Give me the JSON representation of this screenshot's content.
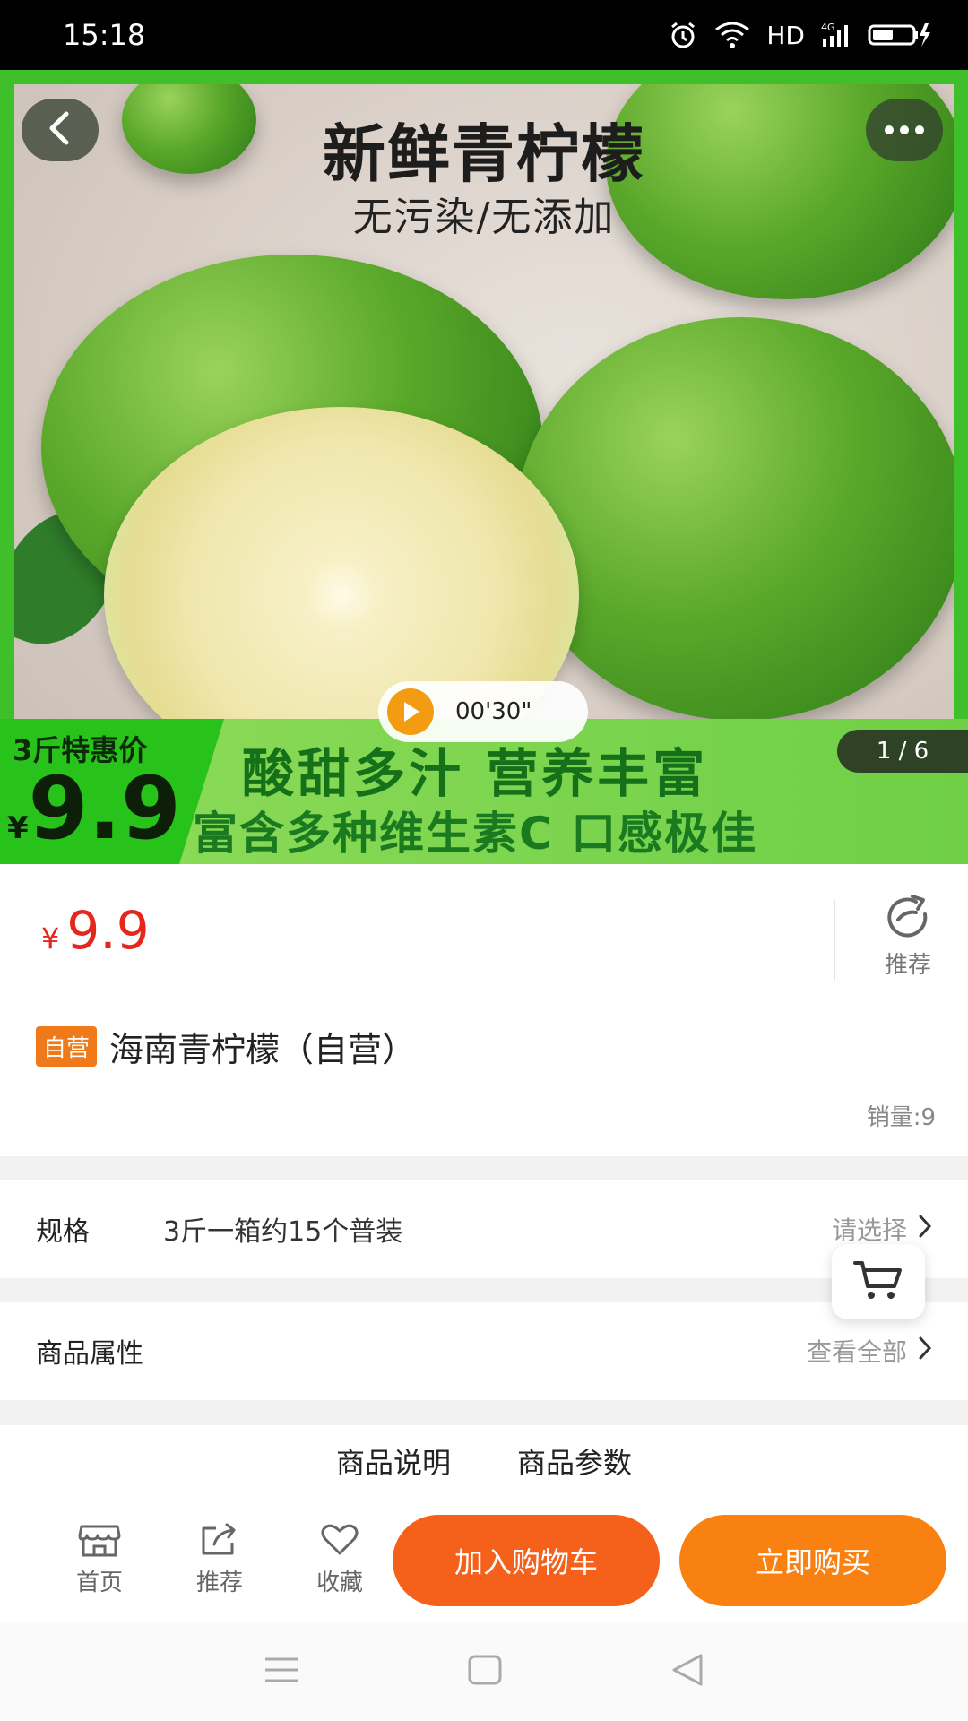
{
  "status_bar": {
    "time": "15:18",
    "hd": "HD",
    "network": "4G",
    "icons": [
      "alarm-icon",
      "wifi-icon",
      "signal-icon",
      "battery-charging-icon"
    ]
  },
  "hero": {
    "title": "新鲜青柠檬",
    "subtitle": "无污染/无添加",
    "promo_label": "3斤特惠价",
    "promo_currency": "¥",
    "promo_price": "9.9",
    "promo_line1": "酸甜多汁 营养丰富",
    "promo_line2": "富含多种维生素C 口感极佳",
    "video_time": "00'30\"",
    "page_indicator": "1 / 6",
    "back_icon": "chevron-left-icon",
    "more_icon": "more-horizontal-icon"
  },
  "product": {
    "currency": "¥",
    "price": "9.9",
    "recommend_label": "推荐",
    "badge": "自营",
    "title": "海南青柠檬（自营）",
    "sales": "销量:9"
  },
  "spec": {
    "label": "规格",
    "value": "3斤一箱约15个普装",
    "action": "请选择"
  },
  "attributes": {
    "label": "商品属性",
    "action": "查看全部"
  },
  "tabs": [
    "商品说明",
    "商品参数"
  ],
  "bottom_bar": {
    "home": "首页",
    "recommend": "推荐",
    "favorite": "收藏",
    "add_to_cart": "加入购物车",
    "buy_now": "立即购买"
  },
  "colors": {
    "price_red": "#e5261c",
    "badge_orange": "#f07a1a",
    "cart_button": "#f5601a",
    "buy_button": "#f88112",
    "hero_green": "#3fbf2a"
  }
}
